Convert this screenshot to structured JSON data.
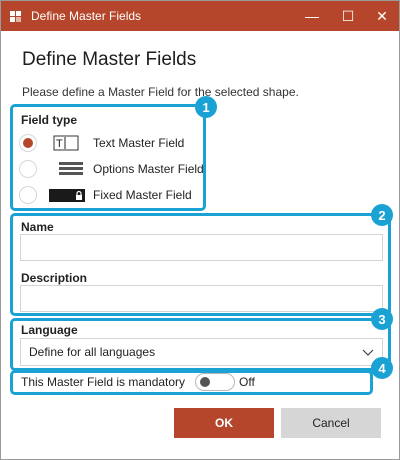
{
  "window": {
    "title": "Define Master Fields",
    "minimize_glyph": "—",
    "maximize_glyph": "☐",
    "close_glyph": "✕"
  },
  "dialog": {
    "heading": "Define Master Fields",
    "subtitle": "Please define a Master Field for the selected shape."
  },
  "callouts": [
    "1",
    "2",
    "3",
    "4"
  ],
  "field_type": {
    "label": "Field type",
    "options": [
      {
        "label": "Text Master Field",
        "icon": "text-field-icon",
        "selected": true
      },
      {
        "label": "Options Master Field",
        "icon": "options-list-icon",
        "selected": false
      },
      {
        "label": "Fixed Master Field",
        "icon": "locked-field-icon",
        "selected": false
      }
    ]
  },
  "name": {
    "label": "Name",
    "value": "",
    "placeholder": ""
  },
  "description": {
    "label": "Description",
    "value": "",
    "placeholder": ""
  },
  "language": {
    "label": "Language",
    "selected": "Define for all languages"
  },
  "mandatory": {
    "label": "This Master Field is mandatory",
    "state_text": "Off",
    "on": false
  },
  "buttons": {
    "ok": "OK",
    "cancel": "Cancel"
  },
  "colors": {
    "accent": "#b5462b",
    "callout": "#1aa2d4",
    "cancel_bg": "#d6d6d6"
  }
}
